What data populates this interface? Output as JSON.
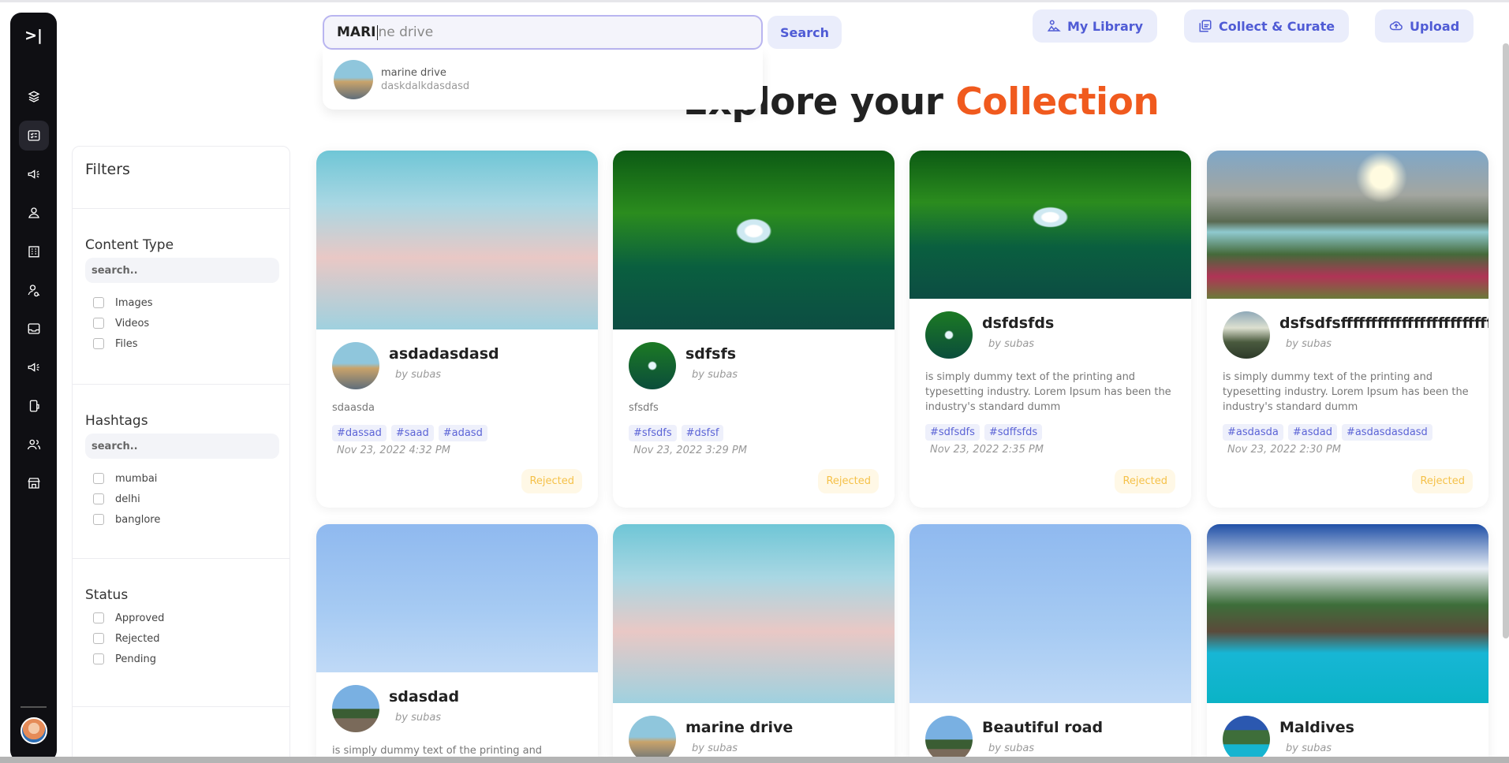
{
  "search": {
    "typed": "MARI",
    "ghost": "ne drive",
    "button": "Search",
    "suggestion": {
      "title": "marine drive",
      "subtitle": "daskdalkdasdasd"
    }
  },
  "top_actions": {
    "library": "My Library",
    "collect": "Collect & Curate",
    "upload": "Upload"
  },
  "heading": {
    "prefix": "Explore your ",
    "accent": "Collection"
  },
  "filters": {
    "title": "Filters",
    "sections": [
      {
        "title": "Content Type",
        "search_placeholder": "search..",
        "options": [
          "Images",
          "Videos",
          "Files"
        ]
      },
      {
        "title": "Hashtags",
        "search_placeholder": "search..",
        "options": [
          "mumbai",
          "delhi",
          "banglore"
        ]
      },
      {
        "title": "Status",
        "options": [
          "Approved",
          "Rejected",
          "Pending"
        ]
      }
    ]
  },
  "cards": [
    {
      "title": "asdadasdasd",
      "by": "by subas",
      "desc": "sdaasda",
      "tags": [
        "#dassad",
        "#saad",
        "#adasd"
      ],
      "date": "Nov 23, 2022 4:32 PM",
      "status": "Rejected"
    },
    {
      "title": "sdfsfs",
      "by": "by subas",
      "desc": "sfsdfs",
      "tags": [
        "#sfsdfs",
        "#dsfsf"
      ],
      "date": "Nov 23, 2022 3:29 PM",
      "status": "Rejected"
    },
    {
      "title": "dsfdsfds",
      "by": "by subas",
      "desc": "is simply dummy text of the printing and typesetting industry. Lorem Ipsum has been the industry's standard dumm",
      "tags": [
        "#sdfsdfs",
        "#sdffsfds"
      ],
      "date": "Nov 23, 2022 2:35 PM",
      "status": "Rejected"
    },
    {
      "title": "dsfsdfsffffffffffffffffffffffffffffffffff",
      "by": "by subas",
      "desc": "is simply dummy text of the printing and typesetting industry. Lorem Ipsum has been the industry's standard dumm",
      "tags": [
        "#asdasda",
        "#asdad",
        "#asdasdasdasd"
      ],
      "date": "Nov 23, 2022 2:30 PM",
      "status": "Rejected"
    },
    {
      "title": "sdasdad",
      "by": "by subas",
      "desc": "is simply dummy text of the printing and"
    },
    {
      "title": "marine drive",
      "by": "by subas"
    },
    {
      "title": "Beautiful road",
      "by": "by subas"
    },
    {
      "title": "Maldives",
      "by": "by subas"
    }
  ],
  "icons": {
    "rail": [
      "expand-icon",
      "book-icon",
      "checklist-icon",
      "megaphone-icon",
      "user-icon",
      "building-icon",
      "user-search-icon",
      "inbox-icon",
      "megaphone-icon",
      "phone-icon",
      "users-icon",
      "store-icon"
    ]
  },
  "colors": {
    "accent": "#f05a1e",
    "primary": "#4f5bd5",
    "rail": "#0f0f13",
    "status_rejected": "#f5c149"
  }
}
